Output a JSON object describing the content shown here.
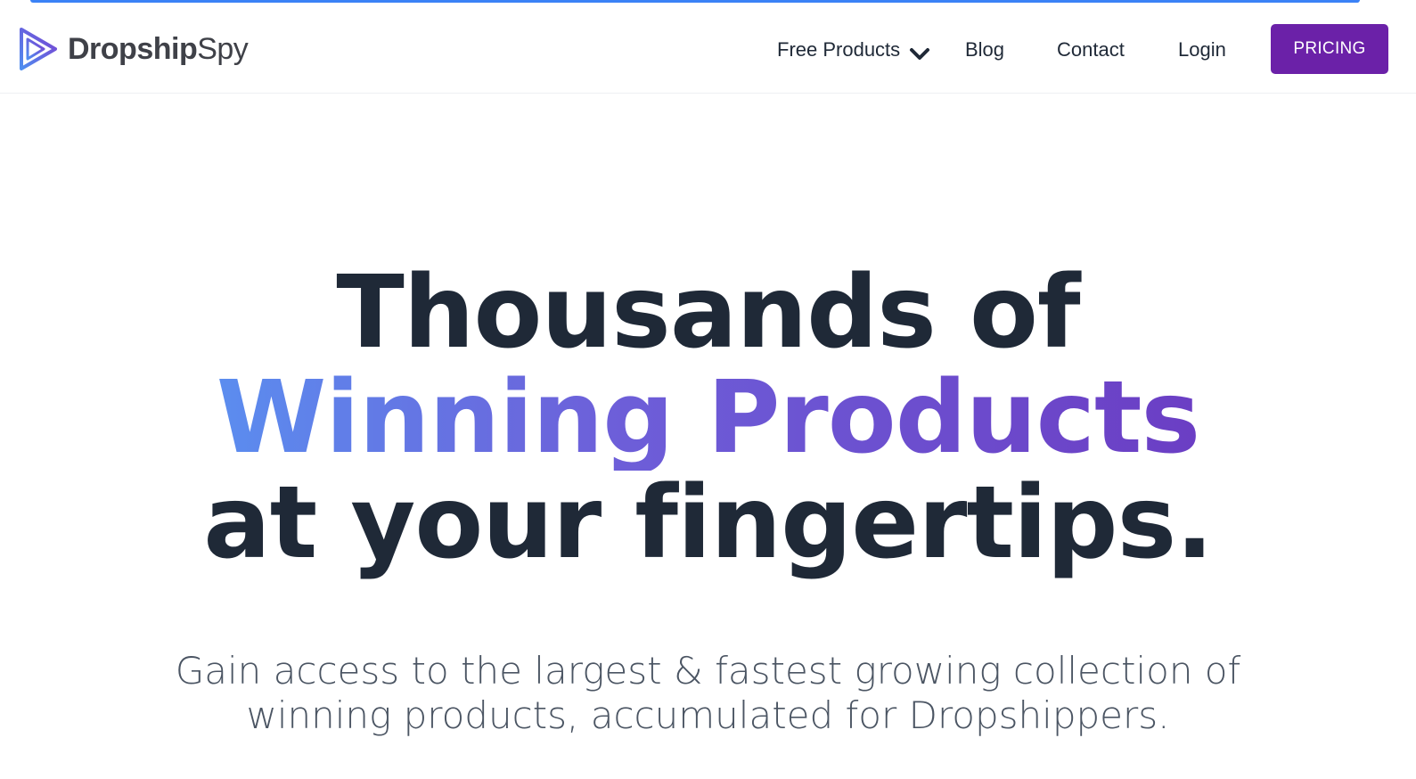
{
  "brand": {
    "name_bold": "Dropship",
    "name_light": "Spy",
    "logo_icon": "play-triangle-icon",
    "accent": "#6b21a8",
    "gradient_start": "#5b8def",
    "gradient_end": "#6b3ec4"
  },
  "nav": {
    "free_products": "Free Products",
    "free_products_icon": "chevron-down-icon",
    "blog": "Blog",
    "contact": "Contact",
    "login": "Login",
    "pricing": "PRICING"
  },
  "hero": {
    "line1": "Thousands of",
    "line2": "Winning Products",
    "line3": "at your fingertips.",
    "subtitle_line1": "Gain access to the largest & fastest growing collection of",
    "subtitle_line2": "winning products, accumulated for Dropshippers."
  }
}
